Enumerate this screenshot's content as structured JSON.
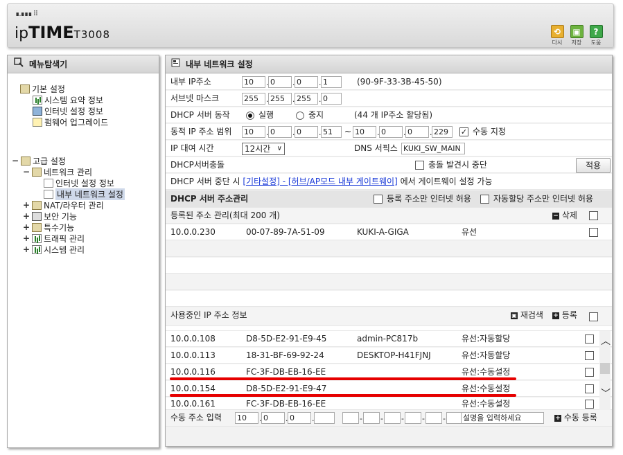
{
  "header": {
    "logo_dots": "∎.∎∎∎ ⠿",
    "logo_prefix": "ip",
    "logo_brand": "TIME",
    "logo_model": "T3008",
    "buttons": [
      {
        "label": "다시",
        "icon": "undo-icon",
        "color": "#e8b030"
      },
      {
        "label": "저장",
        "icon": "save-icon",
        "color": "#6db33f"
      },
      {
        "label": "도움",
        "icon": "help-icon",
        "color": "#3fa84a"
      }
    ]
  },
  "left": {
    "title": "메뉴탐색기",
    "tree": {
      "basic": "기본 설정",
      "basic_items": [
        "시스템 요약 정보",
        "인터넷 설정 정보",
        "펌웨어 업그레이드"
      ],
      "advanced": "고급 설정",
      "network": "네트워크 관리",
      "network_items": [
        "인터넷 설정 정보",
        "내부 네트워크 설정"
      ],
      "others": [
        "NAT/라우터 관리",
        "보안 기능",
        "특수기능",
        "트래픽 관리",
        "시스템 관리"
      ],
      "toggle_minus": "−",
      "toggle_plus": "+"
    }
  },
  "main": {
    "title": "내부 네트워크 설정",
    "internal_ip": {
      "label": "내부 IP주소",
      "octets": [
        "10",
        "0",
        "0",
        "1"
      ],
      "mac": "(90-9F-33-3B-45-50)"
    },
    "subnet": {
      "label": "서브넷 마스크",
      "octets": [
        "255",
        "255",
        "255",
        "0"
      ]
    },
    "dhcp_server": {
      "label": "DHCP 서버 동작",
      "on": "실행",
      "off": "중지",
      "note": "(44 개 IP주소 할당됨)"
    },
    "range": {
      "label": "동적 IP 주소 범위",
      "start": [
        "10",
        "0",
        "0",
        "51"
      ],
      "tilde": "~",
      "end": [
        "10",
        "0",
        "0",
        "229"
      ],
      "manual": "수동 지정"
    },
    "lease": {
      "label": "IP 대여 시간",
      "value": "12시간",
      "dns_label": "DNS 서픽스",
      "dns_value": "KUKI_SW_MAIN"
    },
    "conflict": {
      "label": "DHCP서버충돌",
      "stop_label": "충돌 발견시 중단",
      "apply": "적용"
    },
    "notice": {
      "pre": "DHCP 서버 중단 시",
      "link": "[기타설정] - [허브/AP모드 내부 게이트웨이]",
      "post": "에서 게이트웨이 설정 가능"
    },
    "address_mgmt": {
      "title": "DHCP 서버 주소관리",
      "opt1": "등록 주소만 인터넷 허용",
      "opt2": "자동할당 주소만 인터넷 허용"
    },
    "registered": {
      "title": "등록된 주소 관리(최대 200 개)",
      "delete": "삭제",
      "rows": [
        {
          "ip": "10.0.0.230",
          "mac": "00-07-89-7A-51-09",
          "name": "KUKI-A-GIGA",
          "type": "유선"
        }
      ]
    },
    "in_use": {
      "title": "사용중인 IP 주소 정보",
      "rescan": "재검색",
      "register": "등록",
      "rows": [
        {
          "ip": "10.0.0.108",
          "mac": "D8-5D-E2-91-E9-45",
          "name": "admin-PC817b",
          "type": "유선:자동할당"
        },
        {
          "ip": "10.0.0.113",
          "mac": "18-31-BF-69-92-24",
          "name": "DESKTOP-H41FJNJ",
          "type": "유선:자동할당"
        },
        {
          "ip": "10.0.0.116",
          "mac": "FC-3F-DB-EB-16-EE",
          "name": "",
          "type": "유선:수동설정"
        },
        {
          "ip": "10.0.0.154",
          "mac": "D8-5D-E2-91-E9-47",
          "name": "",
          "type": "유선:수동설정"
        },
        {
          "ip": "10.0.0.161",
          "mac": "FC-3F-DB-EB-16-EE",
          "name": "",
          "type": "유선:수동설정"
        }
      ]
    },
    "manual_input": {
      "label": "수동 주소 입력",
      "octets": [
        "10",
        "0",
        "0",
        ""
      ],
      "desc_placeholder": "설명을 입력하세요",
      "add": "수동 등록"
    },
    "highlight_color": "#e60000"
  }
}
